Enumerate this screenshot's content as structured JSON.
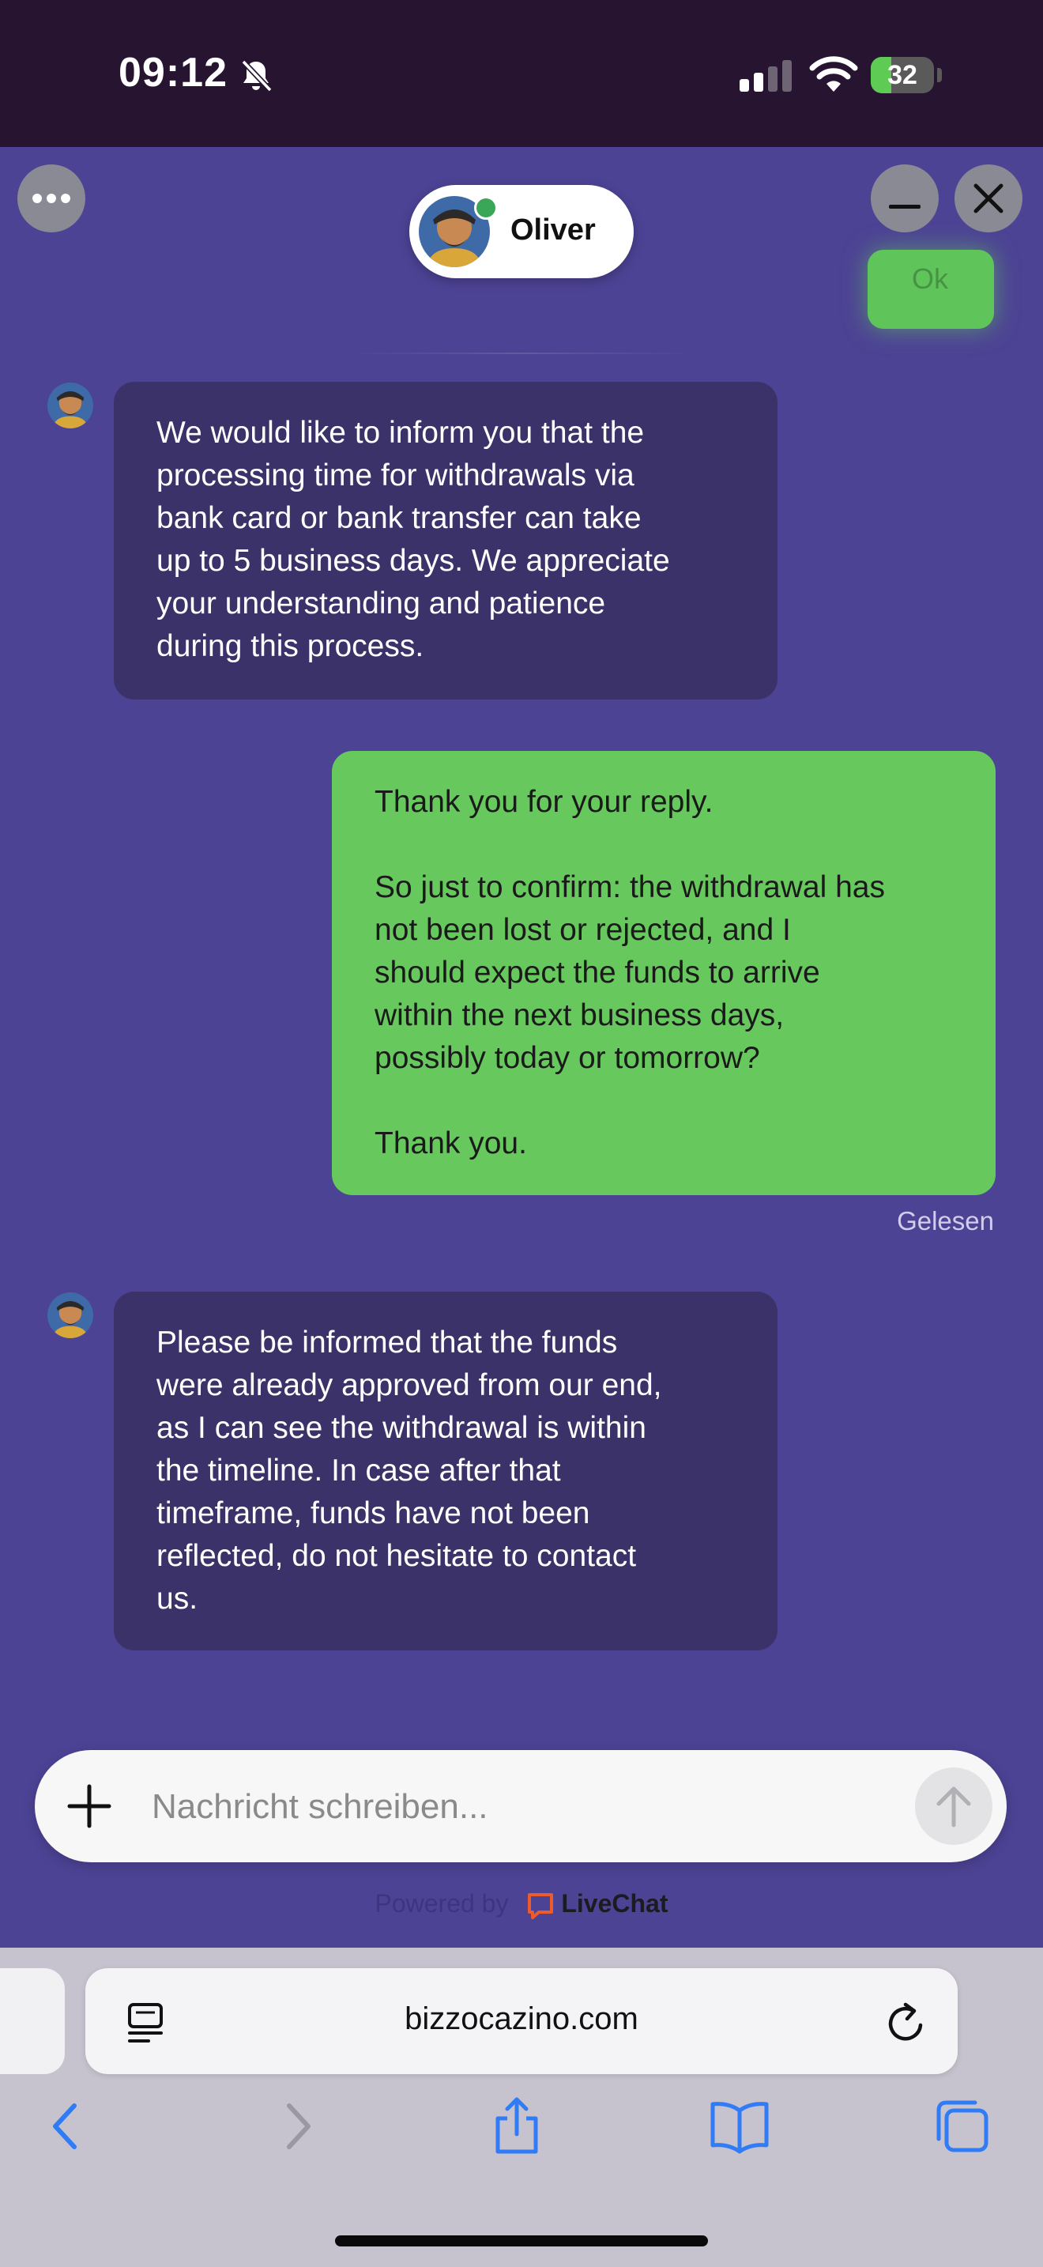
{
  "status_bar": {
    "time": "09:12",
    "battery_level": "32",
    "icons": [
      "bell-slash-icon",
      "cellular-signal-icon",
      "wifi-icon",
      "battery-charging-icon"
    ]
  },
  "chat_header": {
    "agent_name": "Oliver",
    "agent_status": "online",
    "icons": [
      "more-icon",
      "minimize-icon",
      "close-icon"
    ]
  },
  "previous_message": {
    "text": "Ok"
  },
  "messages": [
    {
      "author": "agent",
      "text": "We would like to inform you that the\nprocessing time for withdrawals via\nbank card or bank transfer can take\nup to 5 business days. We appreciate\nyour understanding and patience\nduring this process."
    },
    {
      "author": "user",
      "text": "Thank you for your reply.\n\nSo just to confirm: the withdrawal has\nnot been lost or rejected, and I\nshould expect the funds to arrive\nwithin the next business days,\npossibly today or tomorrow?\n\nThank you.",
      "status": "Gelesen"
    },
    {
      "author": "agent",
      "text": "Please be informed that the funds\nwere already approved from our end,\nas I can see the withdrawal is within\nthe timeline. In case after that\ntimeframe, funds have not been\nreflected, do not hesitate to contact\nus."
    }
  ],
  "composer": {
    "placeholder": "Nachricht schreiben...",
    "value": ""
  },
  "footer": {
    "powered_by": "Powered by",
    "brand": "LiveChat"
  },
  "browser": {
    "url": "bizzocazino.com",
    "toolbar_icons": [
      "back-icon",
      "forward-icon",
      "share-icon",
      "bookmarks-icon",
      "tabs-icon"
    ]
  },
  "colors": {
    "chat_background": "#4d4395",
    "agent_bubble": "#3b3269",
    "user_bubble": "#67c95d",
    "status_bar": "#261430",
    "browser_chrome": "#c7c3ce",
    "link_blue": "#2f7cf6"
  }
}
